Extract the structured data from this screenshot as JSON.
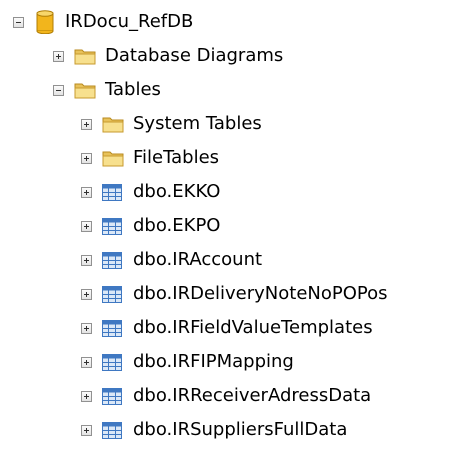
{
  "tree": {
    "nodes": [
      {
        "label": "IRDocu_RefDB",
        "icon": "database-icon",
        "state": "expanded",
        "level": 0
      },
      {
        "label": "Database Diagrams",
        "icon": "folder-icon",
        "state": "collapsed",
        "level": 1
      },
      {
        "label": "Tables",
        "icon": "folder-icon",
        "state": "expanded",
        "level": 1
      },
      {
        "label": "System Tables",
        "icon": "folder-icon",
        "state": "collapsed",
        "level": 2
      },
      {
        "label": "FileTables",
        "icon": "folder-icon",
        "state": "collapsed",
        "level": 2
      },
      {
        "label": "dbo.EKKO",
        "icon": "table-icon",
        "state": "collapsed",
        "level": 2
      },
      {
        "label": "dbo.EKPO",
        "icon": "table-icon",
        "state": "collapsed",
        "level": 2
      },
      {
        "label": "dbo.IRAccount",
        "icon": "table-icon",
        "state": "collapsed",
        "level": 2
      },
      {
        "label": "dbo.IRDeliveryNoteNoPOPos",
        "icon": "table-icon",
        "state": "collapsed",
        "level": 2
      },
      {
        "label": "dbo.IRFieldValueTemplates",
        "icon": "table-icon",
        "state": "collapsed",
        "level": 2
      },
      {
        "label": "dbo.IRFIPMapping",
        "icon": "table-icon",
        "state": "collapsed",
        "level": 2
      },
      {
        "label": "dbo.IRReceiverAdressData",
        "icon": "table-icon",
        "state": "collapsed",
        "level": 2
      },
      {
        "label": "dbo.IRSuppliersFullData",
        "icon": "table-icon",
        "state": "collapsed",
        "level": 2
      }
    ],
    "colors": {
      "folder": "#e8c25a",
      "folder_light": "#f7e08e",
      "database": "#f2b51c",
      "table_blue": "#3f78c2",
      "table_light": "#dbe8f7",
      "expander_sign": "#2f2f2f"
    }
  }
}
